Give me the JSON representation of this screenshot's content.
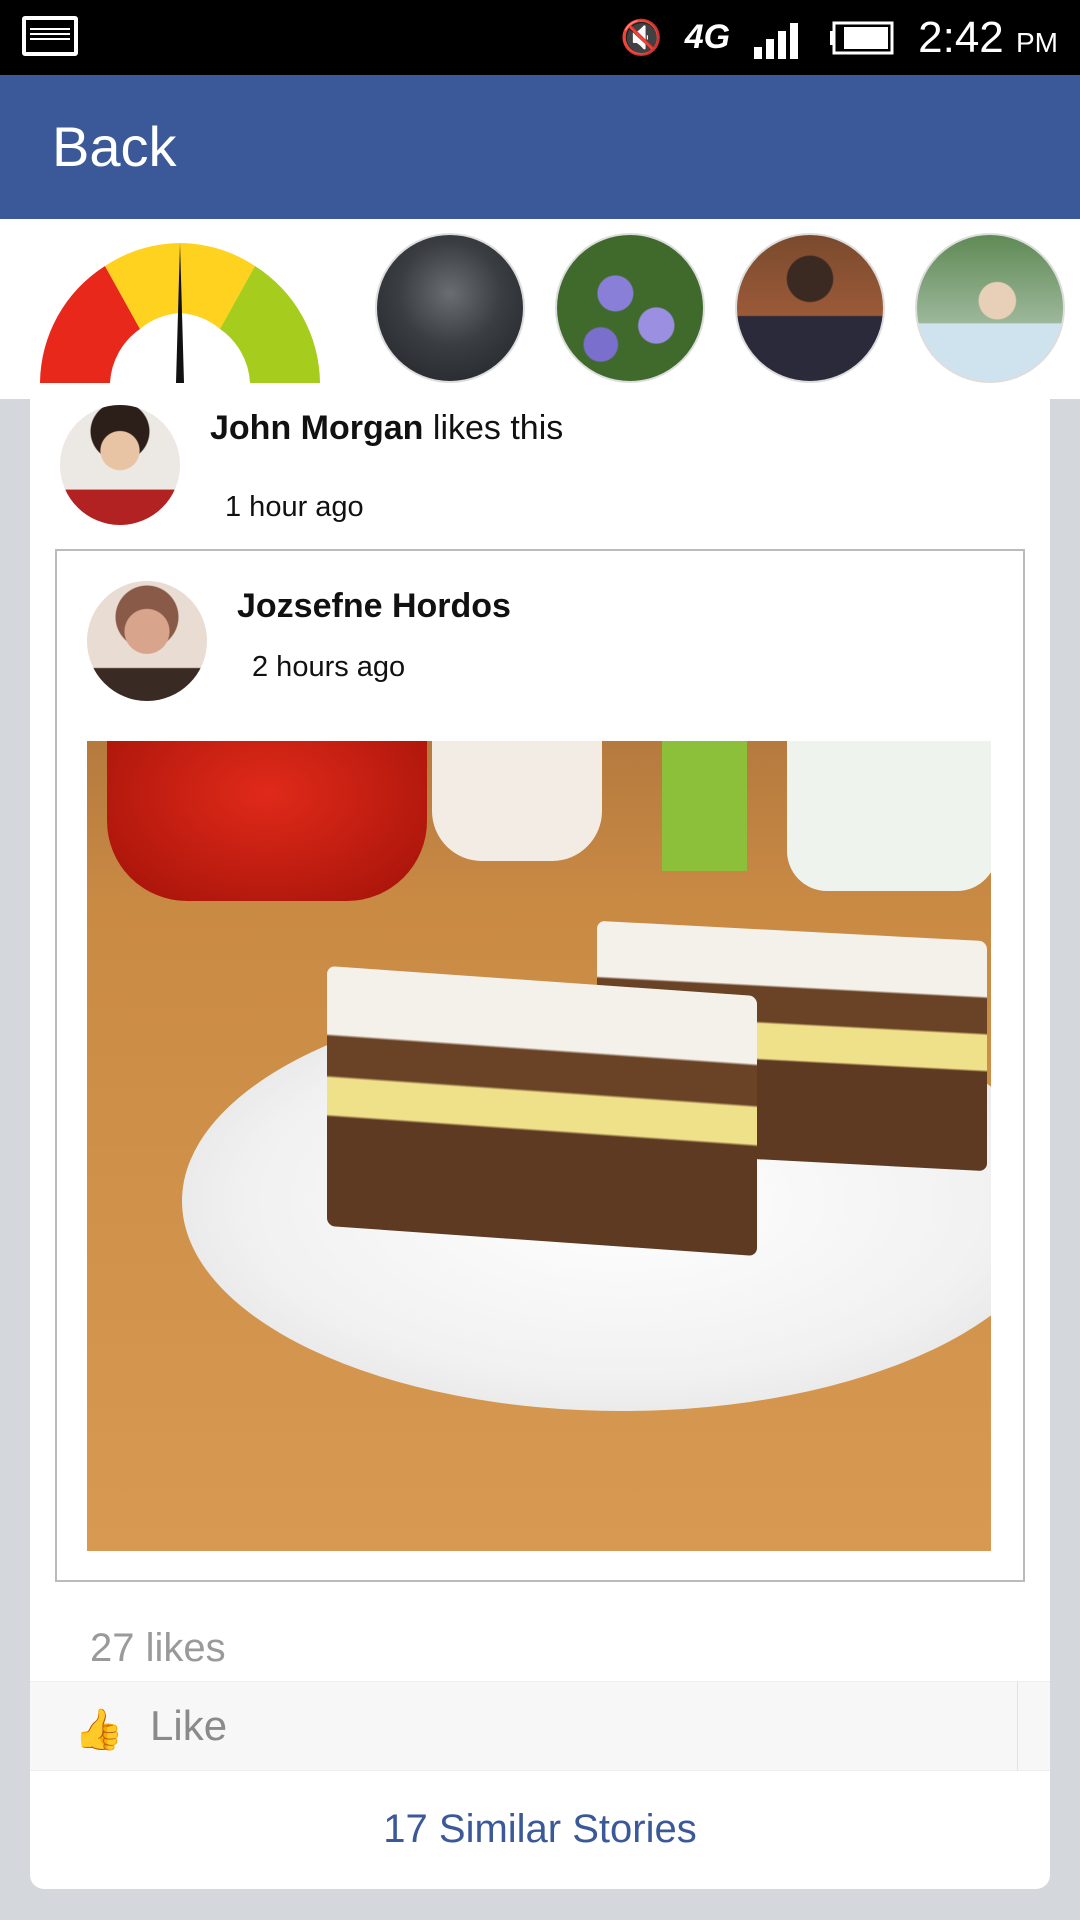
{
  "status_bar": {
    "time": "2:42",
    "ampm": "PM",
    "network": "4G"
  },
  "app_bar": {
    "back_label": "Back"
  },
  "stories": [
    {
      "name": "story-1"
    },
    {
      "name": "story-2"
    },
    {
      "name": "story-3"
    },
    {
      "name": "story-4"
    }
  ],
  "activity": {
    "liker_name": "John Morgan",
    "action": " likes this",
    "time": "1 hour ago"
  },
  "post": {
    "author": "Jozsefne Hordos",
    "time": "2 hours ago",
    "likes_count": "27 likes",
    "like_label": "Like",
    "similar_label": "17 Similar Stories"
  }
}
